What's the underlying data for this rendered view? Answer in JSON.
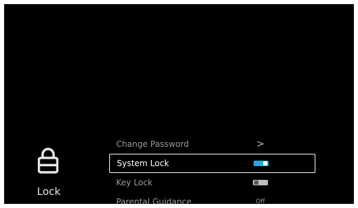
{
  "category": {
    "icon": "lock-icon",
    "label": "Lock"
  },
  "menu": {
    "items": [
      {
        "label": "Change Password",
        "control": "chevron-right-icon",
        "value": ">"
      },
      {
        "label": "System Lock",
        "control": "toggle",
        "state": "on",
        "selected": true
      },
      {
        "label": "Key Lock",
        "control": "toggle",
        "state": "off"
      },
      {
        "label": "Parental Guidance",
        "control": "value",
        "value": "Off"
      }
    ]
  },
  "colors": {
    "background": "#000000",
    "toggle_on": "#29a8e0",
    "toggle_off": "#bfbfbf",
    "selection_border": "#ffffff"
  }
}
